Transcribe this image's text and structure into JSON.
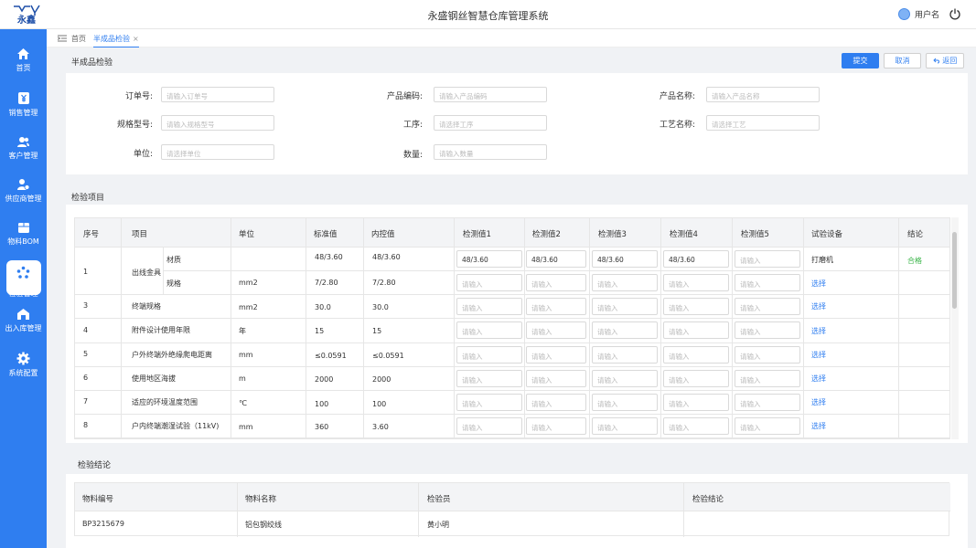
{
  "app": {
    "title": "永盛钢丝智慧仓库管理系统",
    "logo_text": "永鑫",
    "username": "用户名"
  },
  "sidebar": {
    "items": [
      {
        "label": "首页",
        "icon": "home-icon"
      },
      {
        "label": "销售管理",
        "icon": "yen-icon"
      },
      {
        "label": "客户管理",
        "icon": "users-icon"
      },
      {
        "label": "供应商管理",
        "icon": "supplier-icon"
      },
      {
        "label": "物料BOM",
        "icon": "box-icon"
      },
      {
        "label": "检验管理",
        "icon": "inspection-icon",
        "active": true
      },
      {
        "label": "出入库管理",
        "icon": "warehouse-icon"
      },
      {
        "label": "系统配置",
        "icon": "gear-icon"
      }
    ]
  },
  "tabs": {
    "home": "首页",
    "current": "半成品检验",
    "close": "×"
  },
  "page": {
    "title": "半成品检验",
    "submit": "提交",
    "cancel": "取消",
    "back": "返回"
  },
  "form": {
    "order_no": {
      "label": "订单号:",
      "placeholder": "请输入订单号"
    },
    "product_code": {
      "label": "产品编码:",
      "placeholder": "请输入产品编码"
    },
    "product_name": {
      "label": "产品名称:",
      "placeholder": "请输入产品名称"
    },
    "spec_model": {
      "label": "规格型号:",
      "placeholder": "请输入规格型号"
    },
    "process": {
      "label": "工序:",
      "placeholder": "请选择工序"
    },
    "craft_name": {
      "label": "工艺名称:",
      "placeholder": "请选择工艺"
    },
    "unit": {
      "label": "单位:",
      "placeholder": "请选择单位"
    },
    "quantity": {
      "label": "数量:",
      "placeholder": "请输入数量"
    }
  },
  "inspection": {
    "title": "检验项目",
    "headers": [
      "序号",
      "项目",
      "单位",
      "标准值",
      "内控值",
      "检测值1",
      "检测值2",
      "检测值3",
      "检测值4",
      "检测值5",
      "试验设备",
      "结论"
    ],
    "input_placeholder": "请输入",
    "group1": {
      "no": "1",
      "name": "出线金具"
    },
    "rows": [
      {
        "sub": "材质",
        "unit": "",
        "std": "48/3.60",
        "ctrl": "48/3.60",
        "v1": "48/3.60",
        "v2": "48/3.60",
        "v3": "48/3.60",
        "v4": "48/3.60",
        "v5": "",
        "equip": "打磨机",
        "result": "合格"
      },
      {
        "sub": "规格",
        "unit": "mm2",
        "std": "7/2.80",
        "ctrl": "7/2.80",
        "v1": "",
        "v2": "",
        "v3": "",
        "v4": "",
        "v5": "",
        "equip": "选择",
        "result": ""
      },
      {
        "no": "3",
        "name": "终端规格",
        "unit": "mm2",
        "std": "30.0",
        "ctrl": "30.0",
        "equip": "选择"
      },
      {
        "no": "4",
        "name": "附件设计使用年限",
        "unit": "年",
        "std": "15",
        "ctrl": "15",
        "equip": "选择"
      },
      {
        "no": "5",
        "name": "户外终端外绝缘爬电距离",
        "unit": "mm",
        "std": "≤0.0591",
        "ctrl": "≤0.0591",
        "equip": "选择"
      },
      {
        "no": "6",
        "name": "使用地区海拔",
        "unit": "m",
        "std": "2000",
        "ctrl": "2000",
        "equip": "选择"
      },
      {
        "no": "7",
        "name": "适应的环境温度范围",
        "unit": "℃",
        "std": "100",
        "ctrl": "100",
        "equip": "选择"
      },
      {
        "no": "8",
        "name": "户内终端潮湿试验（11kV)",
        "unit": "mm",
        "std": "360",
        "ctrl": "3.60",
        "equip": "选择"
      }
    ]
  },
  "conclusion": {
    "title": "检验结论",
    "headers": [
      "物料编号",
      "物料名称",
      "检验员",
      "检验结论"
    ],
    "row": {
      "material_no": "BP3215679",
      "material_name": "铝包钢绞线",
      "inspector": "黄小明",
      "result": ""
    }
  },
  "colors": {
    "primary": "#2f7ef0",
    "pass": "#3bb54a"
  }
}
